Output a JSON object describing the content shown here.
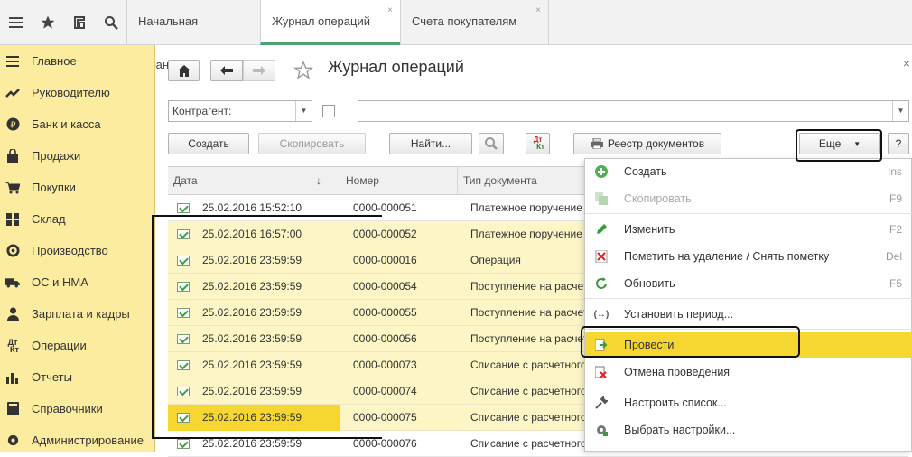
{
  "tabs": [
    {
      "label": "Начальная страница"
    },
    {
      "label": "Журнал операций",
      "close": "×"
    },
    {
      "label": "Счета покупателям",
      "close": "×"
    }
  ],
  "sidebar": {
    "items": [
      {
        "label": "Главное",
        "icon": "menu-lines-icon"
      },
      {
        "label": "Руководителю",
        "icon": "chart-trend-icon"
      },
      {
        "label": "Банк и касса",
        "icon": "ruble-icon"
      },
      {
        "label": "Продажи",
        "icon": "shopping-bag-icon"
      },
      {
        "label": "Покупки",
        "icon": "cart-icon"
      },
      {
        "label": "Склад",
        "icon": "grid-icon"
      },
      {
        "label": "Производство",
        "icon": "factory-icon"
      },
      {
        "label": "ОС и НМА",
        "icon": "truck-icon"
      },
      {
        "label": "Зарплата и кадры",
        "icon": "person-icon"
      },
      {
        "label": "Операции",
        "icon": "dt-kt-icon"
      },
      {
        "label": "Отчеты",
        "icon": "bar-chart-icon"
      },
      {
        "label": "Справочники",
        "icon": "book-icon"
      },
      {
        "label": "Администрирование",
        "icon": "gear-icon"
      }
    ]
  },
  "header": {
    "title": "Журнал операций",
    "close": "×"
  },
  "filters": {
    "counterparty_label": "Контрагент:",
    "search_value": ""
  },
  "toolbar": {
    "create": "Создать",
    "copy": "Скопировать",
    "find": "Найти...",
    "registry": "Реестр документов",
    "more": "Еще",
    "help": "?",
    "dtkt_top": "Дт",
    "dtkt_bottom": "Кт"
  },
  "table": {
    "columns": [
      "Дата",
      "Номер",
      "Тип документа"
    ],
    "sort_arrow": "↓",
    "rows": [
      {
        "date": "25.02.2016 15:52:10",
        "number": "0000-000051",
        "type": "Платежное поручение"
      },
      {
        "date": "25.02.2016 16:57:00",
        "number": "0000-000052",
        "type": "Платежное поручение"
      },
      {
        "date": "25.02.2016 23:59:59",
        "number": "0000-000016",
        "type": "Операция"
      },
      {
        "date": "25.02.2016 23:59:59",
        "number": "0000-000054",
        "type": "Поступление на расчетный счет"
      },
      {
        "date": "25.02.2016 23:59:59",
        "number": "0000-000055",
        "type": "Поступление на расчетный счет"
      },
      {
        "date": "25.02.2016 23:59:59",
        "number": "0000-000056",
        "type": "Поступление на расчетный счет"
      },
      {
        "date": "25.02.2016 23:59:59",
        "number": "0000-000073",
        "type": "Списание с расчетного счета"
      },
      {
        "date": "25.02.2016 23:59:59",
        "number": "0000-000074",
        "type": "Списание с расчетного счета"
      },
      {
        "date": "25.02.2016 23:59:59",
        "number": "0000-000075",
        "type": "Списание с расчетного счета"
      },
      {
        "date": "25.02.2016 23:59:59",
        "number": "0000-000076",
        "type": "Списание с расчетного счета"
      }
    ]
  },
  "menu": {
    "items": [
      {
        "label": "Создать",
        "shortcut": "Ins"
      },
      {
        "label": "Скопировать",
        "shortcut": "F9"
      },
      {
        "label": "Изменить",
        "shortcut": "F2"
      },
      {
        "label": "Пометить на удаление / Снять пометку",
        "shortcut": "Del"
      },
      {
        "label": "Обновить",
        "shortcut": "F5"
      },
      {
        "label": "Установить период...",
        "shortcut": ""
      },
      {
        "label": "Провести",
        "shortcut": ""
      },
      {
        "label": "Отмена проведения",
        "shortcut": ""
      },
      {
        "label": "Настроить список...",
        "shortcut": ""
      },
      {
        "label": "Выбрать настройки...",
        "shortcut": ""
      }
    ]
  },
  "colors": {
    "sidebar_bg": "#fbeca0",
    "highlight": "#f6d631",
    "selected_row": "#fdf5c6",
    "active_tab_underline": "#4aa36f"
  }
}
